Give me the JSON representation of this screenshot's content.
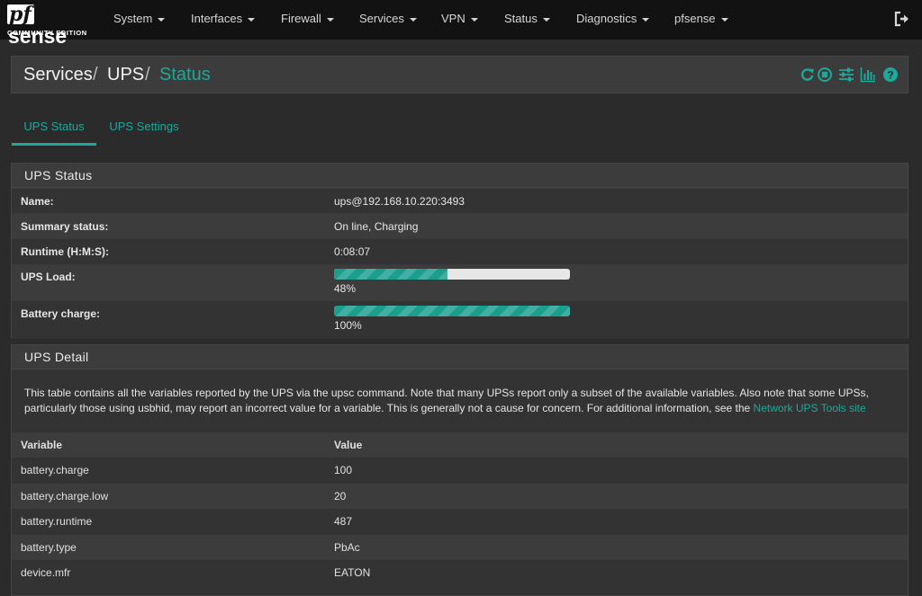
{
  "brand": {
    "pf": "pf",
    "sense": "sense",
    "edition": "COMMUNITY EDITION"
  },
  "nav": [
    {
      "label": "System"
    },
    {
      "label": "Interfaces"
    },
    {
      "label": "Firewall"
    },
    {
      "label": "Services"
    },
    {
      "label": "VPN"
    },
    {
      "label": "Status"
    },
    {
      "label": "Diagnostics"
    },
    {
      "label": "pfsense"
    }
  ],
  "breadcrumb": {
    "part1": "Services",
    "part2": "UPS",
    "current": "Status",
    "separator": "/"
  },
  "header_icons": [
    "restart-icon",
    "stop-icon",
    "settings-sliders-icon",
    "chart-icon",
    "help-icon"
  ],
  "tabs": {
    "status": "UPS Status",
    "settings": "UPS Settings"
  },
  "ups_status": {
    "title": "UPS Status",
    "name_label": "Name:",
    "name_value": "ups@192.168.10.220:3493",
    "summary_label": "Summary status:",
    "summary_value": "On line, Charging",
    "runtime_label": "Runtime (H:M:S):",
    "runtime_value": "0:08:07",
    "load_label": "UPS Load:",
    "load_value": "48%",
    "load_fraction": 0.48,
    "battery_label": "Battery charge:",
    "battery_value": "100%",
    "battery_fraction": 1.0
  },
  "ups_detail": {
    "title": "UPS Detail",
    "note": "This table contains all the variables reported by the UPS via the upsc command. Note that many UPSs report only a subset of the available variables. Also note that some UPSs, particularly those using usbhid, may report an incorrect value for a variable. This is generally not a cause for concern. For additional information, see the ",
    "note_link": "Network UPS Tools site",
    "col_variable": "Variable",
    "col_value": "Value",
    "rows": [
      {
        "variable": "battery.charge",
        "value": "100"
      },
      {
        "variable": "battery.charge.low",
        "value": "20"
      },
      {
        "variable": "battery.runtime",
        "value": "487"
      },
      {
        "variable": "battery.type",
        "value": "PbAc"
      },
      {
        "variable": "device.mfr",
        "value": "EATON"
      }
    ]
  },
  "colors": {
    "accent": "#1ea89a",
    "navbar": "#121212",
    "background": "#2b2b2b"
  }
}
